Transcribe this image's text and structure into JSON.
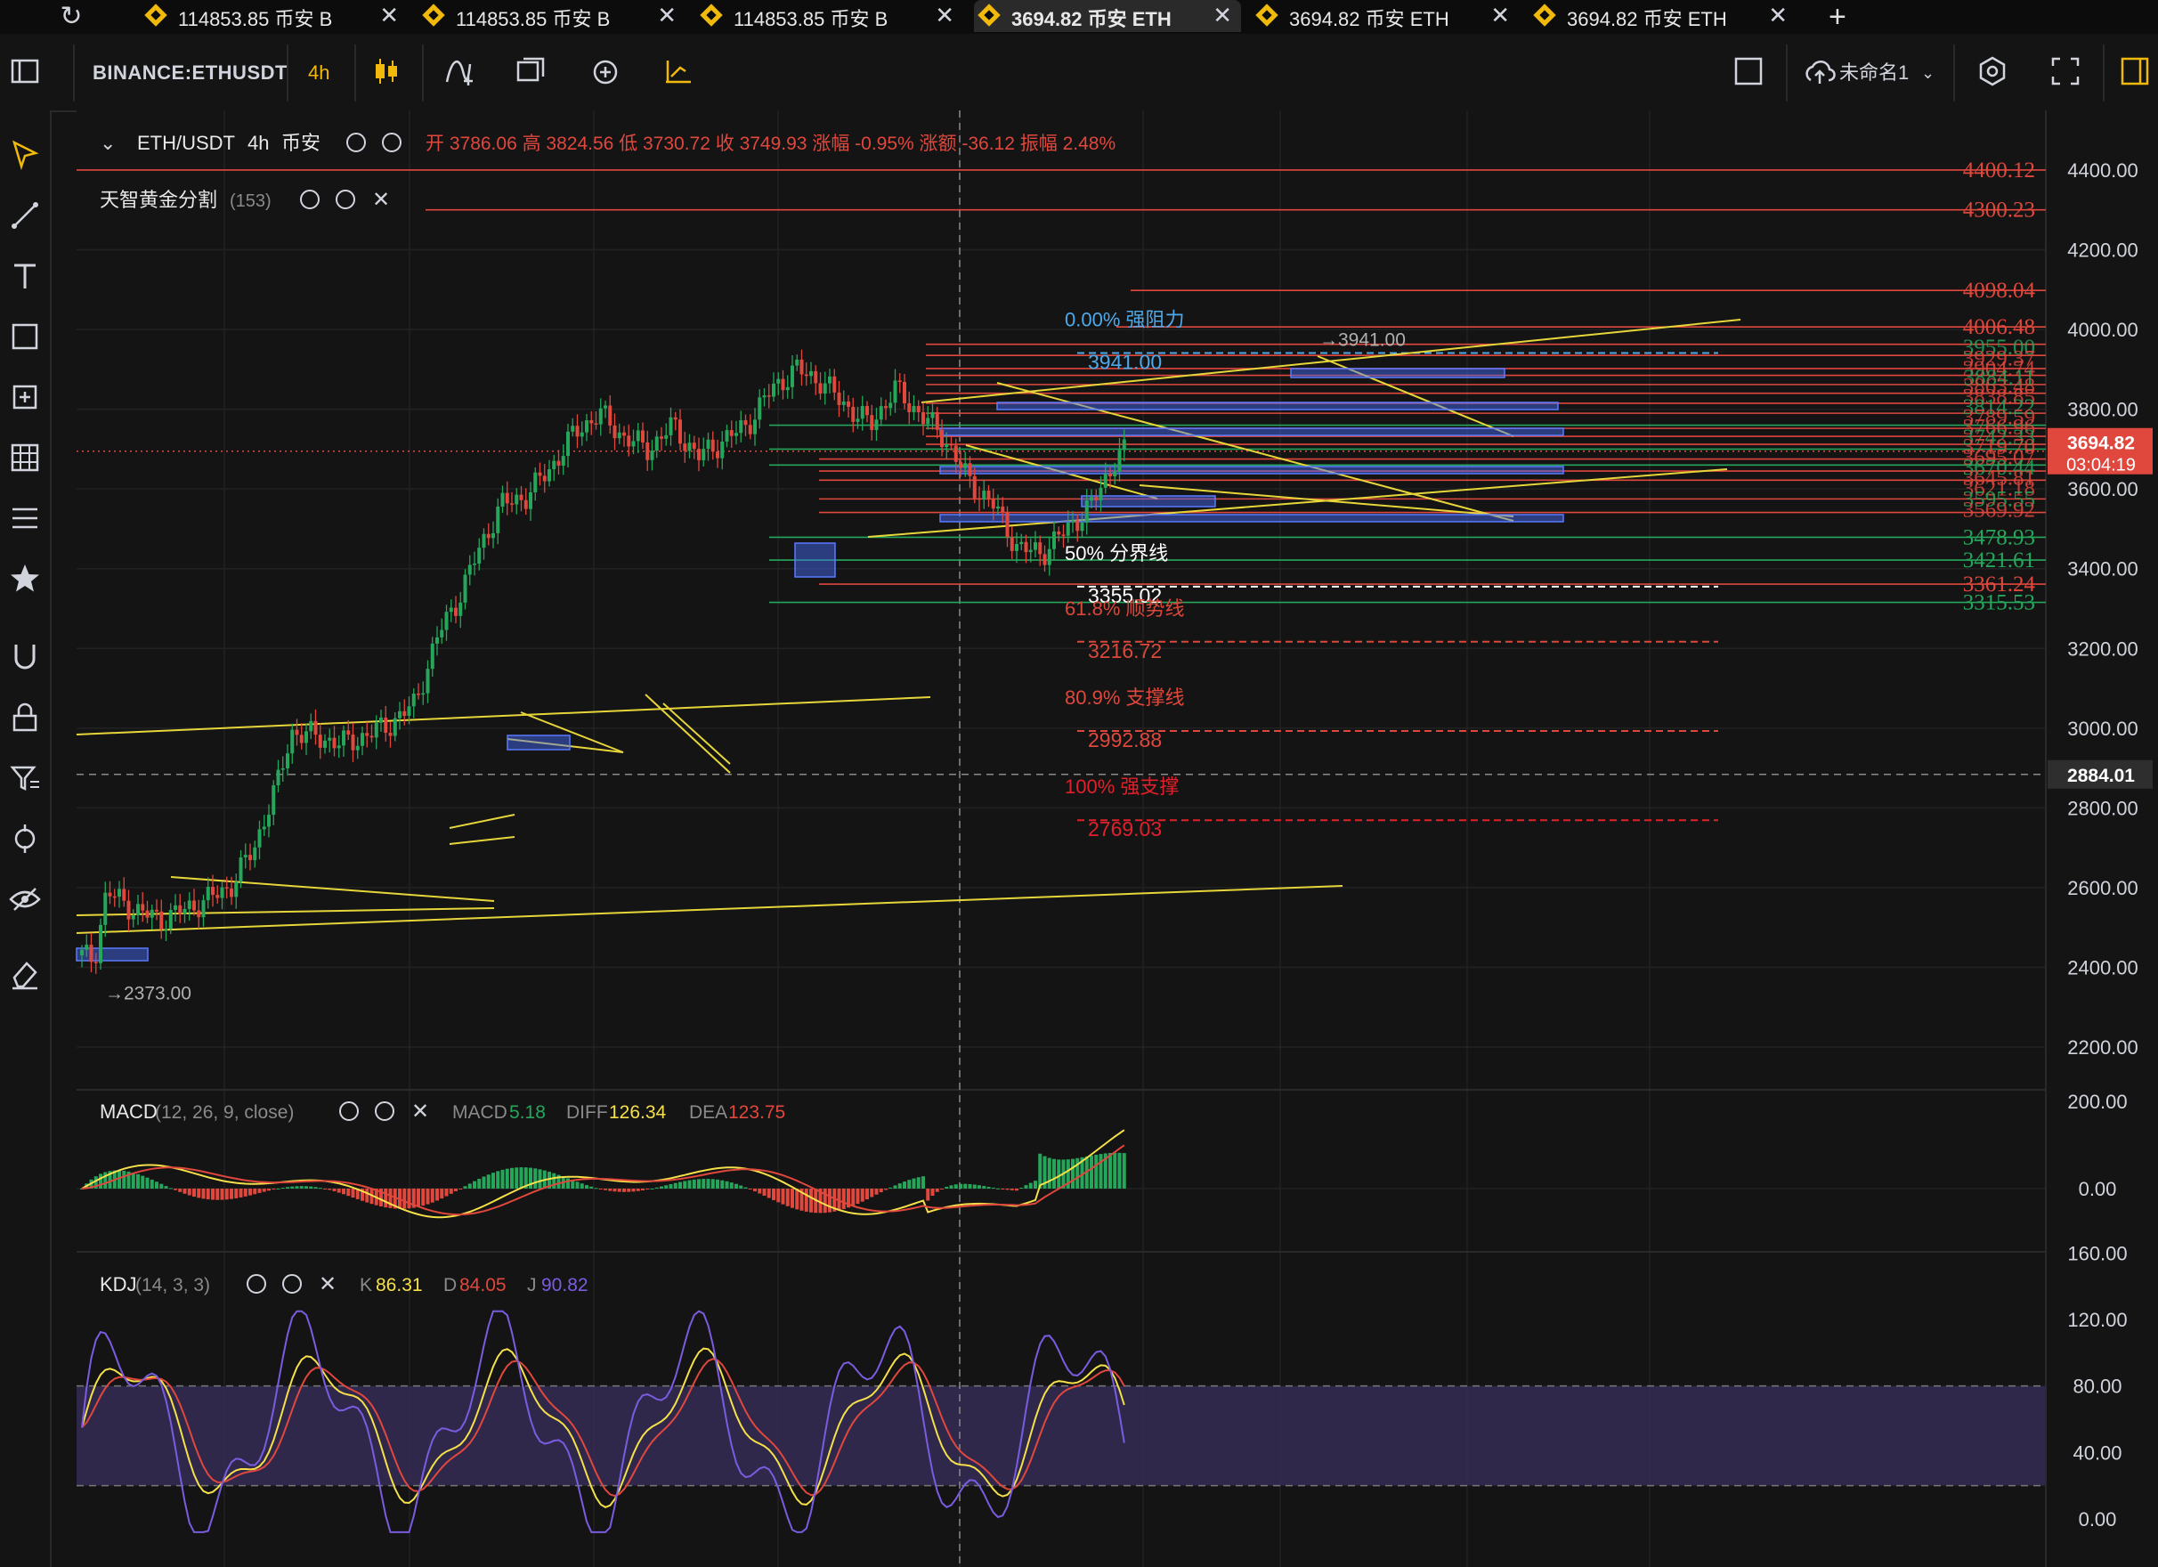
{
  "tabs": [
    {
      "label": "114853.85 币安 B",
      "active": false
    },
    {
      "label": "114853.85 币安 B",
      "active": false
    },
    {
      "label": "114853.85 币安 B",
      "active": false
    },
    {
      "label": "3694.82 币安 ETH",
      "active": true
    },
    {
      "label": "3694.82 币安 ETH",
      "active": false
    },
    {
      "label": "3694.82 币安 ETH",
      "active": false
    }
  ],
  "toolbar": {
    "symbol": "BINANCE:ETHUSDT",
    "interval": "4h",
    "layout_name": "未命名1",
    "icons": [
      "sidebar-toggle-icon",
      "candles-icon",
      "indicators-icon",
      "templates-icon",
      "alert-icon",
      "replay-icon",
      "square-icon",
      "cloud-save-icon",
      "settings-icon",
      "fullscreen-icon",
      "panel-icon"
    ]
  },
  "left_tools": [
    "cursor-icon",
    "trendline-icon",
    "text-icon",
    "rectangle-icon",
    "measure-icon",
    "grid-icon",
    "fib-lines-icon",
    "star-icon",
    "magnet-icon",
    "lock-icon",
    "filter-icon",
    "crosshair-icon",
    "eye-icon",
    "eraser-icon"
  ],
  "legend": {
    "series": "ETH/USDT",
    "interval": "4h",
    "exchange": "币安",
    "ohlc_text": "开 3786.06 高 3824.56 低 3730.72 收 3749.93 涨幅 -0.95% 涨额 -36.12 振幅 2.48%",
    "indicator": "天智黄金分割",
    "indicator_count": "(153)"
  },
  "colors": {
    "up": "#26a65b",
    "down": "#e0473d",
    "trendline": "#e7d63a",
    "price_tag": "#e0473d",
    "kdj_band": "#3a2f5c",
    "macd_line": "#f5e049",
    "signal_line": "#e0473d",
    "j_line": "#7a5ce0"
  },
  "chart_data": {
    "type": "candlestick",
    "price_axis": {
      "ticks": [
        4400,
        4200,
        4000,
        3800,
        3600,
        3400,
        3200,
        3000,
        2800,
        2600,
        2400,
        2200
      ],
      "range": [
        2180,
        4500
      ]
    },
    "price_axis_labels": [
      "4400.00",
      "4200.00",
      "4000.00",
      "3800.00",
      "3600.00",
      "3400.00",
      "3200.00",
      "3000.00",
      "2800.00",
      "2600.00",
      "2400.00",
      "2200.00"
    ],
    "last_price": {
      "price": 3694.82,
      "label": "3694.82",
      "countdown": "03:04:19"
    },
    "crosshair_price": {
      "price": 2884.01,
      "label": "2884.01"
    },
    "fib_levels": [
      {
        "pct_label": "0.00% 强阻力",
        "value": 3941.0,
        "value_label": "3941.00",
        "color": "#4fa8e8"
      },
      {
        "pct_label": "50% 分界线",
        "value": 3355.02,
        "value_label": "3355.02",
        "color": "#ffffff"
      },
      {
        "pct_label": "61.8% 顺势线",
        "value": 3216.72,
        "value_label": "3216.72",
        "color": "#d9483b"
      },
      {
        "pct_label": "80.9% 支撑线",
        "value": 2992.88,
        "value_label": "2992.88",
        "color": "#e0473d"
      },
      {
        "pct_label": "100% 强支撑",
        "value": 2769.03,
        "value_label": "2769.03",
        "color": "#e0202a"
      }
    ],
    "right_levels": [
      {
        "value": 4400.12,
        "label": "4400.12",
        "color": "#e0473d"
      },
      {
        "value": 4300.23,
        "label": "4300.23",
        "color": "#e0473d"
      },
      {
        "value": 4098.04,
        "label": "4098.04",
        "color": "#e0473d"
      },
      {
        "value": 4006.48,
        "label": "4006.48",
        "color": "#e0473d"
      },
      {
        "value": 3478.93,
        "label": "3478.93",
        "color": "#26a65b"
      },
      {
        "value": 3421.61,
        "label": "3421.61",
        "color": "#26a65b"
      },
      {
        "value": 3361.24,
        "label": "3361.24",
        "color": "#e0473d"
      },
      {
        "value": 3315.53,
        "label": "3315.53",
        "color": "#26a65b"
      }
    ],
    "annotations": [
      {
        "text": "→3941.00",
        "value": 3941.0
      },
      {
        "text": "→2373.00",
        "value": 2373.0
      }
    ]
  },
  "macd": {
    "title": "MACD",
    "params": "(12, 26, 9, close)",
    "macd_label": "MACD",
    "macd_value": "5.18",
    "diff_label": "DIFF",
    "diff_value": "126.34",
    "dea_label": "DEA",
    "dea_value": "123.75",
    "axis_labels": [
      "200.00",
      "0.00"
    ],
    "range": [
      -100,
      210
    ]
  },
  "kdj": {
    "title": "KDJ",
    "params": "(14, 3, 3)",
    "k_label": "K",
    "k_value": "86.31",
    "d_label": "D",
    "d_value": "84.05",
    "j_label": "J",
    "j_value": "90.82",
    "axis_labels": [
      "160.00",
      "120.00",
      "80.00",
      "40.00",
      "0.00"
    ],
    "range": [
      -10,
      165
    ],
    "band": [
      20,
      80
    ]
  }
}
